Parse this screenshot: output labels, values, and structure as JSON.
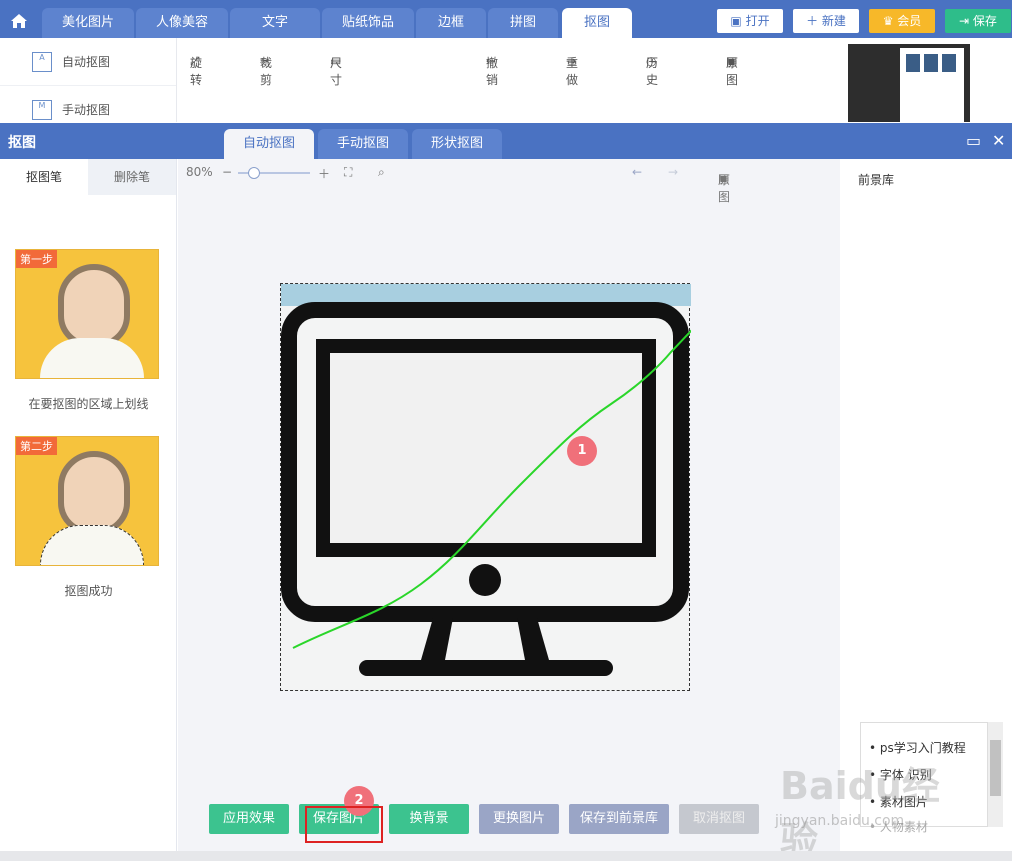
{
  "topbar": {
    "tabs": [
      "美化图片",
      "人像美容",
      "文字",
      "贴纸饰品",
      "边框",
      "拼图",
      "抠图"
    ],
    "buttons": {
      "open": "打开",
      "new": "新建",
      "vip": "会员",
      "save": "保存"
    }
  },
  "bg": {
    "left_items": [
      "自动抠图",
      "手动抠图"
    ],
    "tools": [
      "旋转",
      "裁剪",
      "尺寸",
      "撤销",
      "重做",
      "历史",
      "原图"
    ]
  },
  "dialog": {
    "title": "抠图",
    "tabs": [
      "自动抠图",
      "手动抠图",
      "形状抠图"
    ],
    "left_tabs": [
      "抠图笔",
      "删除笔"
    ],
    "step1_badge": "第一步",
    "step1_caption": "在要抠图的区域上划线",
    "step2_badge": "第二步",
    "step2_caption": "抠图成功",
    "zoom": "80%",
    "original": "原图",
    "right_title": "前景库",
    "buttons": [
      "应用效果",
      "保存图片",
      "换背景",
      "更换图片",
      "保存到前景库",
      "取消抠图"
    ],
    "marker1": "1",
    "marker2": "2",
    "popup_items": [
      "ps学习入门教程",
      "字体 识别",
      "素材图片",
      "人物素材"
    ]
  },
  "watermark": {
    "brand": "Baidu经验",
    "url": "jingyan.baidu.com"
  },
  "colors": {
    "primary": "#4a72c2",
    "green": "#3cc38f",
    "gray": "#9aa5c6",
    "marker": "#f0707a"
  }
}
